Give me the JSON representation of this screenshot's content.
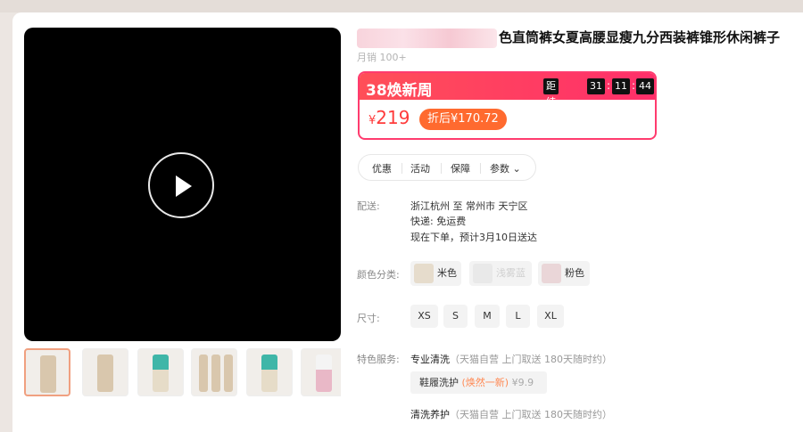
{
  "product": {
    "title": "色直筒裤女夏高腰显瘦九分西装裤锥形休闲裤子",
    "sales": "月销 100+"
  },
  "promo": {
    "name": "38焕新周",
    "ends_label": "距结束",
    "countdown": [
      "31",
      "11",
      "44"
    ],
    "currency": "¥",
    "price": "219",
    "after_price": "折后¥170.72"
  },
  "tabs": [
    "优惠",
    "活动",
    "保障",
    "参数"
  ],
  "delivery": {
    "label": "配送:",
    "route": "浙江杭州 至 常州市 天宁区",
    "shipping": "快递: 免运费",
    "eta": "现在下单，预计3月10日送达"
  },
  "colors": {
    "label": "颜色分类:",
    "options": [
      "米色",
      "浅雾蓝",
      "粉色"
    ]
  },
  "sizes": {
    "label": "尺寸:",
    "options": [
      "XS",
      "S",
      "M",
      "L",
      "XL"
    ]
  },
  "services": {
    "label": "特色服务:",
    "items": [
      {
        "name": "专业清洗",
        "note": "（天猫自营 上门取送 180天随时约）"
      },
      {
        "name": "清洗养护",
        "note": "（天猫自营 上门取送 180天随时约）"
      }
    ],
    "chip": {
      "name": "鞋履洗护",
      "highlight": "(焕然一新)",
      "price": "¥9.9"
    }
  },
  "accent_colors": {
    "promo": "#ff3b6e",
    "price": "#ff3b3b",
    "discount": "#ff6a2f"
  }
}
